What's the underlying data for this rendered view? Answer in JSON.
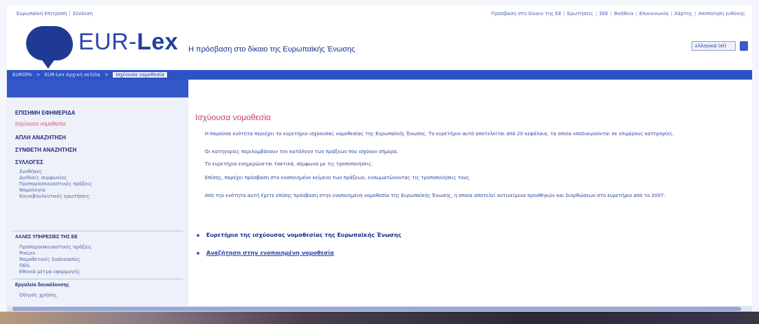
{
  "utilbar": {
    "left_items": [
      "Ευρωπαϊκή Επιτροπή",
      "Σύνδεση"
    ],
    "right_items": [
      "Πρόσβαση στο δίκαιο της ΕΕ",
      "Ερωτήσεις",
      "ΣΕΕ",
      "Βοήθεια",
      "Επικοινωνία",
      "Χάρτης",
      "Αποποίηση ευθύνης"
    ]
  },
  "header": {
    "logo_eur": "EUR-",
    "logo_lex": "Lex",
    "tagline": "Η πρόσβαση στο δίκαιο της Ευρωπαϊκής Ένωσης",
    "language_value": "ελληνικά (el)"
  },
  "breadcrumb": {
    "items": [
      "EUROPA",
      ">",
      "EUR-Lex Αρχική σελίδα",
      ">"
    ],
    "current": "Ισχύουσα νομοθεσία"
  },
  "sidebar": {
    "items": [
      {
        "label": "ΕΠΙΣΗΜΗ ΕΦΗΜΕΡΙΔΑ",
        "style": "bold"
      },
      {
        "label": "Ισχύουσα νομοθεσία",
        "style": "active"
      },
      {
        "label": "ΑΠΛΗ ΑΝΑΖΗΤΗΣΗ",
        "style": "bold"
      },
      {
        "label": "ΣΥΝΘΕΤΗ ΑΝΑΖΗΤΗΣΗ",
        "style": "bold"
      },
      {
        "label": "ΣΥΛΛΟΓΕΣ",
        "style": "bold"
      }
    ],
    "collections": [
      "Συνθήκες",
      "Διεθνείς συμφωνίες",
      "Προπαρασκευαστικές πράξεις",
      "Νομολογία",
      "Κοινοβουλευτικές ερωτήσεις"
    ],
    "section2_title": "ΑΛΛΕΣ ΥΠΗΡΕΣΙΕΣ ΤΗΣ ΕΕ",
    "section2_items": [
      "Προπαρασκευαστικές πράξεις",
      "PreLex",
      "Νομοθετικές διαδικασίες",
      "OEIL",
      "Εθνικά μέτρα εφαρμογής"
    ],
    "section3_title": "Εργαλεία διευκόλυνσης",
    "section3_items": [
      "Οδηγός χρήσης"
    ]
  },
  "main": {
    "title": "Ισχύουσα νομοθεσία",
    "paragraphs": [
      "Η παρούσα ενότητα περιέχει το ευρετήριο ισχύουσας νομοθεσίας της Ευρωπαϊκής Ένωσης. Το ευρετήριο αυτό αποτελείται από 20 κεφάλαια, τα οποία υποδιαιρούνται σε επιμέρους κατηγορίες.",
      "Οι κατηγορίες περιλαμβάνουν τον κατάλογο των πράξεων που ισχύουν σήμερα.",
      "Το ευρετήριο ενημερώνεται τακτικά, σύμφωνα με τις τροποποιήσεις.",
      "Επίσης, παρέχει πρόσβαση στο ενοποιημένο κείμενο των πράξεων, ενσωματώνοντας τις τροποποιήσεις τους.",
      "Από την ενότητα αυτή έχετε επίσης πρόσβαση στην ενοποιημένη νομοθεσία της Ευρωπαϊκής Ένωσης, η οποία αποτελεί αντικείμενο προσθηκών και διορθώσεων στο ευρετήριο από το 2007."
    ],
    "bullets": [
      {
        "label": "Ευρετήριο της ισχύουσας νομοθεσίας της Ευρωπαϊκής Ένωσης",
        "link": false
      },
      {
        "label": "Αναζήτηση στην ενοποιημένη νομοθεσία",
        "link": true
      }
    ]
  }
}
